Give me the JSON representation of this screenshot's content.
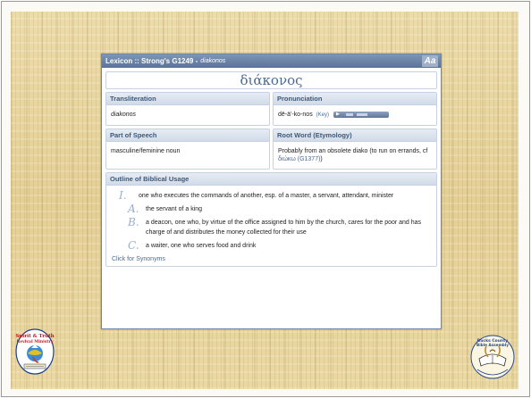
{
  "window": {
    "title": "Lexicon :: Strong's G1249 - ",
    "title_word": "diakonos",
    "font_button": "Aa"
  },
  "headword": "διάκονος",
  "transliteration": {
    "heading": "Transliteration",
    "value": "diakonos"
  },
  "pronunciation": {
    "heading": "Pronunciation",
    "value": "dē-ä'-ko-nos",
    "key_label": "(Key)"
  },
  "part_of_speech": {
    "heading": "Part of Speech",
    "value": "masculine/feminine noun"
  },
  "root_word": {
    "heading": "Root Word (Etymology)",
    "value": "Probably from an obsolete diako (to run on errands, cf ",
    "link": "διώκω (G1377)",
    "suffix": ")"
  },
  "outline": {
    "heading": "Outline of Biblical Usage",
    "items": [
      {
        "marker": "I.",
        "text": "one who executes the commands of another, esp. of a master, a servant, attendant, minister"
      },
      {
        "marker": "A.",
        "text": "the servant of a king"
      },
      {
        "marker": "B.",
        "text": "a deacon, one who, by virtue of the office assigned to him by the church, cares for the poor and has charge of and distributes the money collected for their use"
      },
      {
        "marker": "C.",
        "text": "a waiter, one who serves food and drink"
      }
    ],
    "synonyms_link": "Click for Synonyms"
  },
  "logos": {
    "left_name": "spirit-and-truth-revival-ministry-logo",
    "left_text_top": "Spirit & Truth",
    "left_text_mid": "Revival Ministry",
    "right_name": "bucks-county-bible-assembly-logo",
    "right_text_top": "Bucks County",
    "right_text_mid": "Bible Assembly"
  },
  "colors": {
    "accent": "#5a7396",
    "link": "#4a6a94",
    "parchment": "#e9d7a4"
  }
}
